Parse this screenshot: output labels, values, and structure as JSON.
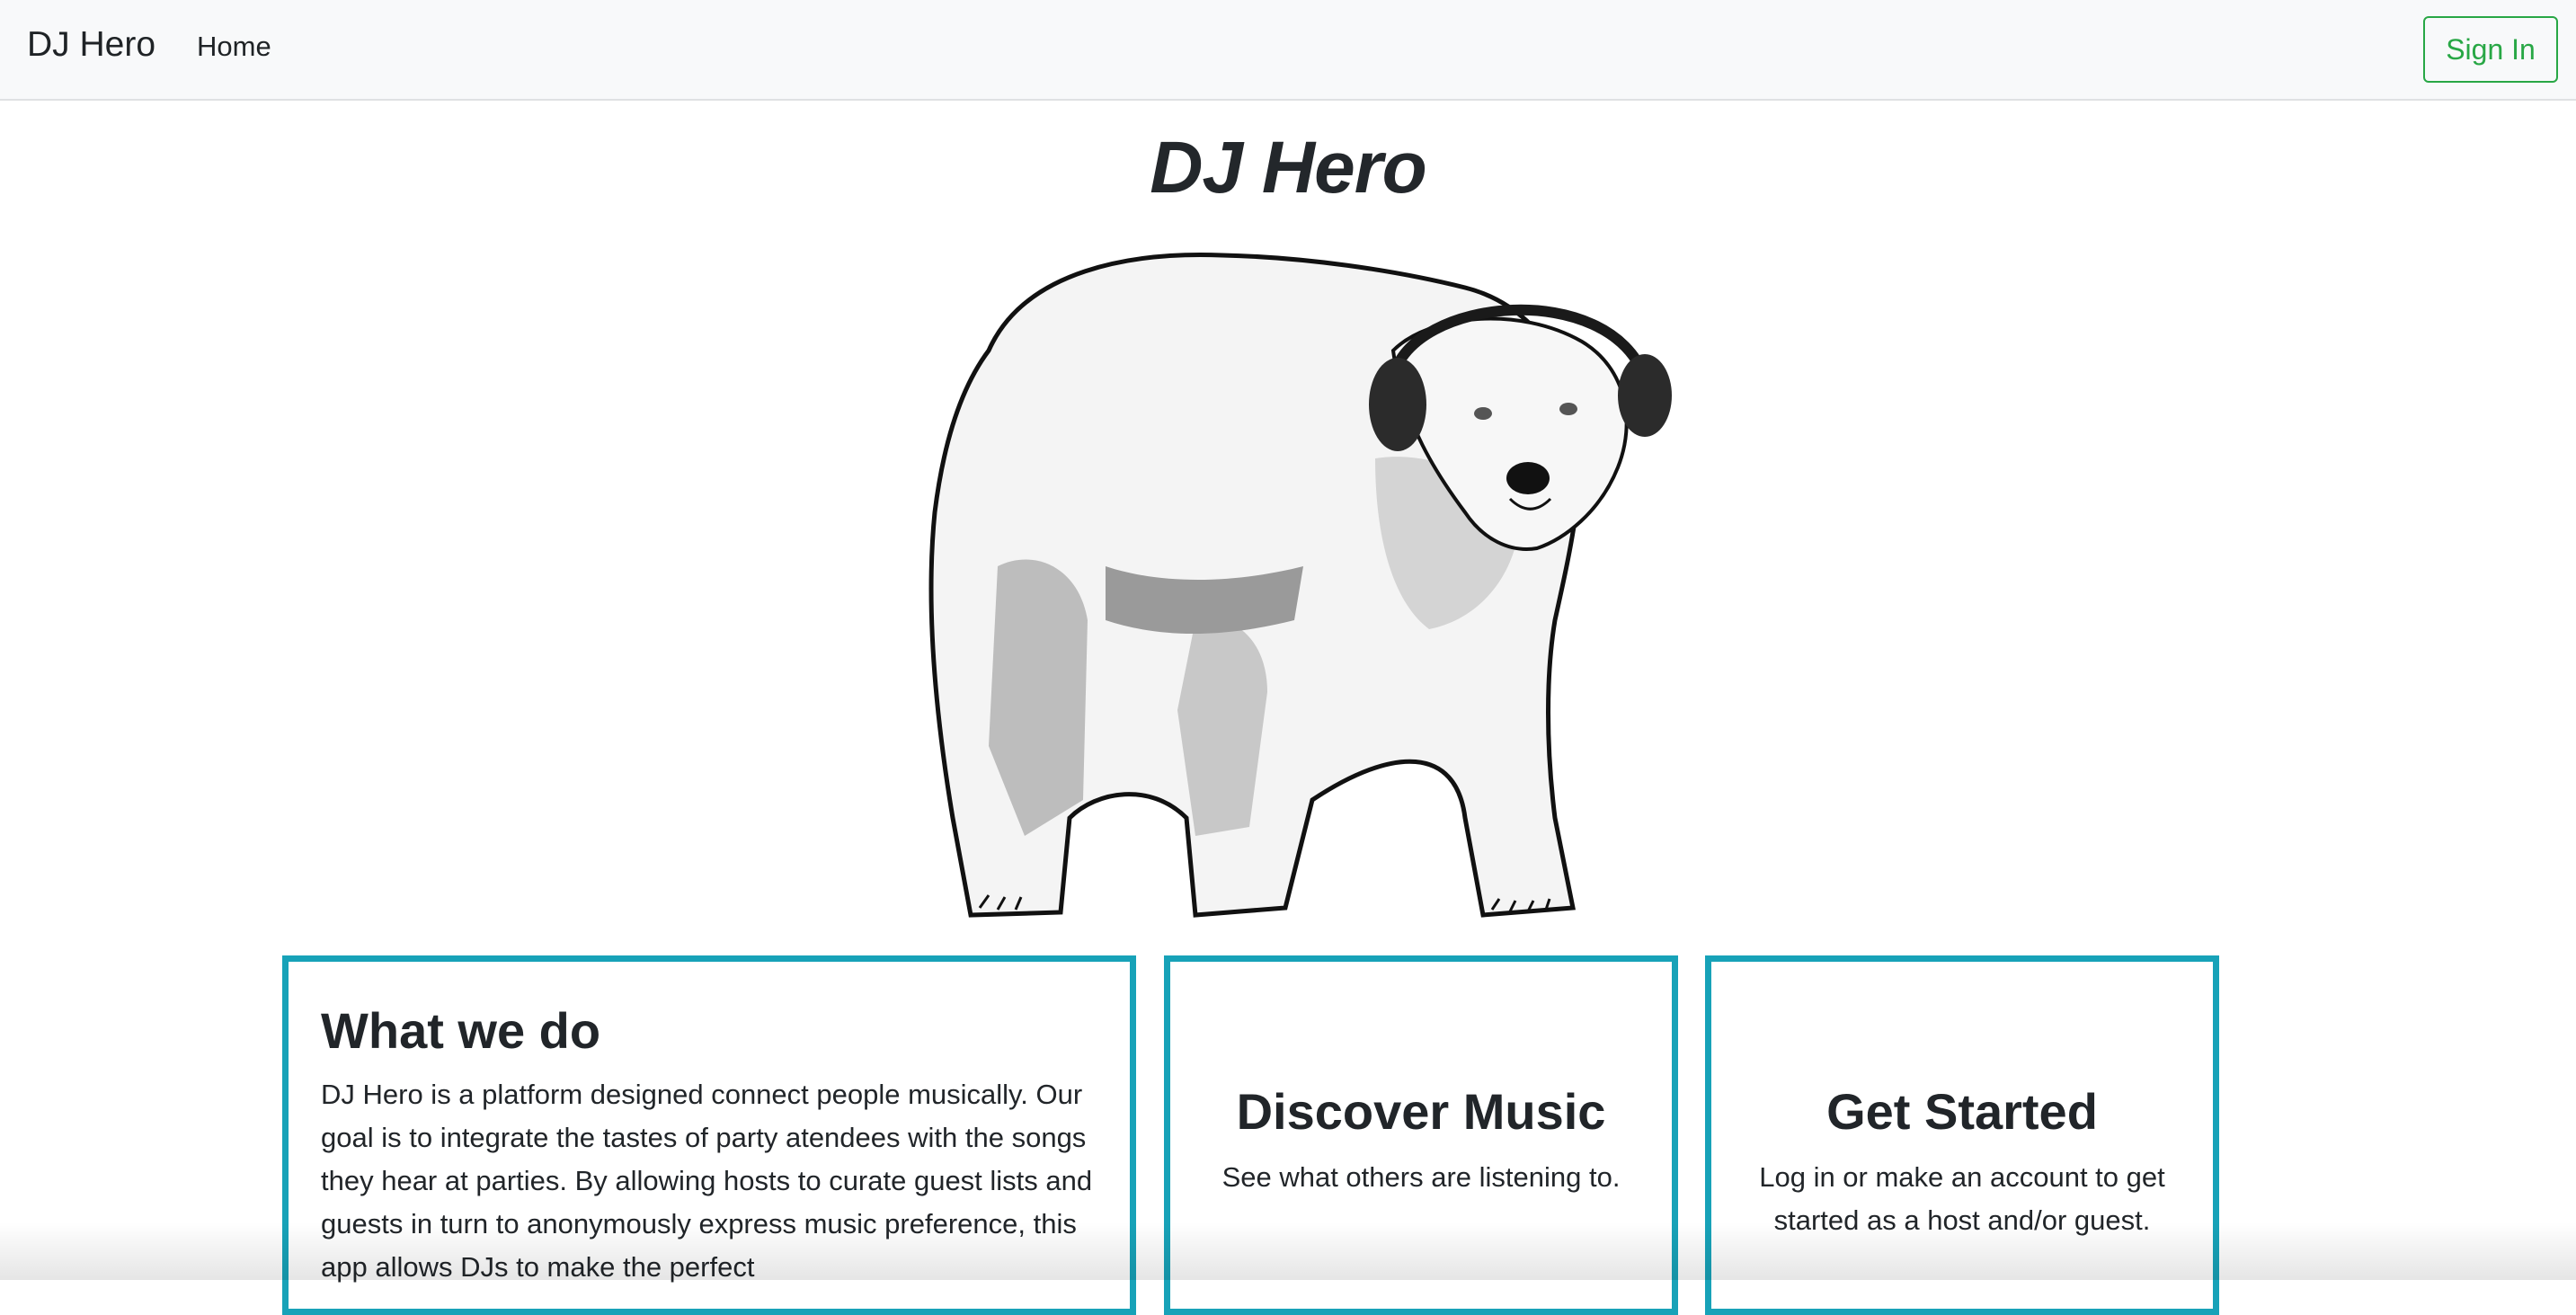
{
  "navbar": {
    "brand": "DJ Hero",
    "home_link": "Home",
    "sign_in_label": "Sign In",
    "sign_in_color": "#28a745"
  },
  "hero": {
    "title": "DJ Hero",
    "image_icon": "polar-bear-with-headphones-illustration"
  },
  "cards": {
    "border_color": "#17a2b8",
    "what_we_do": {
      "title": "What we do",
      "body": "DJ Hero is a platform designed connect people musically. Our goal is to integrate the tastes of party atendees with the songs they hear at parties. By allowing hosts to curate guest lists and guests in turn to anonymously express music preference, this app allows DJs to make the perfect"
    },
    "discover": {
      "title": "Discover Music",
      "body": "See what others are listening to."
    },
    "get_started": {
      "title": "Get Started",
      "body": "Log in or make an account to get started as a host and/or guest."
    }
  }
}
